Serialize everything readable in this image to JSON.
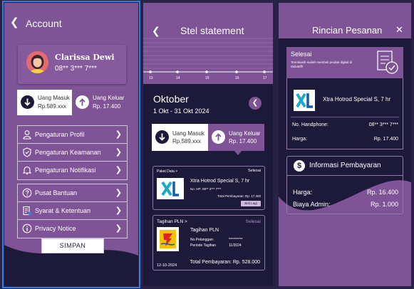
{
  "account": {
    "back_icon": "chevron-left-icon",
    "title": "Account",
    "profile": {
      "name": "Clarissa Dewi",
      "phone": "08** 3*** 7***"
    },
    "balance": {
      "in_label": "Uang Masuk",
      "in_value": "Rp.589.xxx",
      "out_label": "Uang Keluar",
      "out_value": "Rp. 17.400"
    },
    "menu_group_1": [
      {
        "label": "Pengaturan Profil",
        "icon": "user-icon"
      },
      {
        "label": "Pengaturan Keamanan",
        "icon": "shield-icon"
      },
      {
        "label": "Pengaturan Notifikasi",
        "icon": "bell-icon"
      }
    ],
    "menu_group_2": [
      {
        "label": "Pusat Bantuan",
        "icon": "help-icon"
      },
      {
        "label": "Syarat & Ketentuan",
        "icon": "document-icon"
      },
      {
        "label": "Privacy Notice",
        "icon": "info-icon"
      }
    ],
    "save_label": "SIMPAN"
  },
  "statement": {
    "title": "Stel statement",
    "ticks": [
      "13",
      "14",
      "15",
      "16",
      "17"
    ],
    "month": "Oktober",
    "range": "1 Okt - 31 Okt 2024",
    "balance": {
      "in_label": "Uang Masuk",
      "in_value": "Rp.589.xxx",
      "out_label": "Uang Keluar",
      "out_value": "Rp. 17.400"
    },
    "data_card": {
      "category": "Paket Data  >",
      "status": "Selesai",
      "name": "Xtra Hotrod Special S, 7 hr",
      "sub": "No. HP: 08** 3*** 7***",
      "total": "Total Pembayaran: Rp. 17.400",
      "button": "Beli Lagi"
    },
    "pln_card": {
      "category": "Tagihan PLN  >",
      "status": "Selesai",
      "name": "Tagihan PLN",
      "k1": "No.Pelanggan:",
      "v1": "**********",
      "k2": "Periode Tagihan",
      "v2": "11/2024",
      "date": "12-10-2024",
      "total": "Total Pembayaran: Rp. 528.000"
    }
  },
  "detail": {
    "title": "Rincian Pesanan",
    "close_icon": "close-icon",
    "success": {
      "title": "Selesai",
      "sub": "Terimkasih sudah membeli produk digital di Sidvatiff!"
    },
    "product": "Xtra Hotrod Special S, 7 hr",
    "phone_label": "No. Handphone:",
    "phone_value": "08** 3*** 7***",
    "price_label": "Harga:",
    "price_value": "Rp. 17.400",
    "payment": {
      "title": "Informasi Pembayaran",
      "price_label": "Harga:",
      "price_value": "Rp. 16.400",
      "admin_label": "Biaya Admin:",
      "admin_value": "Rp. 1.000"
    }
  },
  "colors": {
    "purple": "#7e5497",
    "navy": "#1d1938",
    "bg": "#272246",
    "select": "#2f7fe0"
  }
}
